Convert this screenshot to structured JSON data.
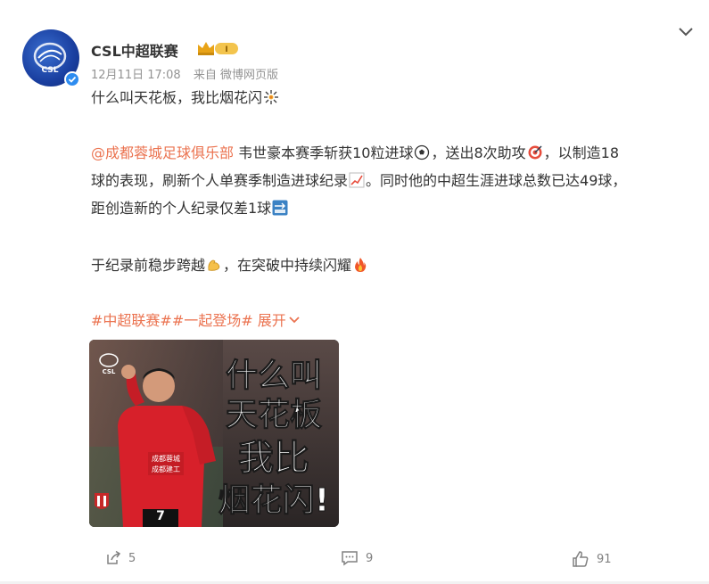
{
  "post": {
    "author": "CSL中超联赛",
    "date": "12月11日 17:08",
    "source": "来自 微博网页版",
    "line1": "什么叫天花板，我比烟花闪",
    "mention": "@成都蓉城足球俱乐部",
    "line2a": " 韦世豪本赛季斩获10粒进球",
    "line2b": "，送出8次助攻",
    "line2c": "，以制造18",
    "line3a": "球的表现，刷新个人单赛季制造进球纪录",
    "line3b": "。同时他的中超生涯进球总数已达49球，",
    "line4": "距创造新的个人纪录仅差1球",
    "line5a": "于纪录前稳步跨越",
    "line5b": "，在突破中持续闪耀",
    "hashtag1": "#中超联赛#",
    "hashtag2": "#一起登场#",
    "expand": "展开",
    "poster_text": [
      "什么叫",
      "天花板",
      "我比",
      "烟花闪!"
    ],
    "jersey_text": [
      "成都蓉城",
      "成都建工"
    ],
    "jersey_number": "7"
  },
  "actions": {
    "repost_count": "5",
    "comment_count": "9",
    "like_count": "91"
  },
  "colors": {
    "link": "#eb7350",
    "meta": "#939393",
    "verified": "#2d8cf0"
  }
}
